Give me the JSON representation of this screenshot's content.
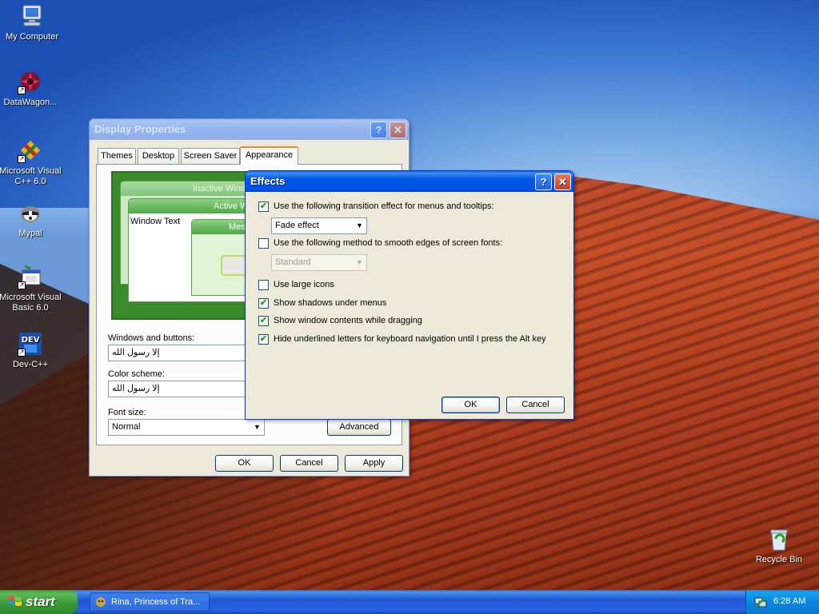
{
  "desktop": {
    "icons": [
      {
        "label": "My Computer",
        "icon": "my-computer-icon"
      },
      {
        "label": "DataWagon...",
        "icon": "datawagon-icon"
      },
      {
        "label": "Microsoft Visual C++ 6.0",
        "icon": "visual-cpp-icon"
      },
      {
        "label": "Mypal",
        "icon": "mypal-icon"
      },
      {
        "label": "Microsoft Visual Basic 6.0",
        "icon": "visual-basic-icon"
      },
      {
        "label": "Dev-C++",
        "icon": "dev-cpp-icon"
      },
      {
        "label": "Recycle Bin",
        "icon": "recycle-bin-icon"
      }
    ]
  },
  "display_properties": {
    "title": "Display Properties",
    "help_btn": "?",
    "close_btn": "✕",
    "tabs": [
      "Themes",
      "Desktop",
      "Screen Saver",
      "Appearance"
    ],
    "active_tab": "Appearance",
    "preview": {
      "inactive_title": "Inactive Window",
      "active_title": "Active Window",
      "window_text": "Window Text",
      "message_title": "Message Box"
    },
    "windows_buttons_label": "Windows and buttons:",
    "windows_buttons_value": "إلا رسول الله",
    "color_scheme_label": "Color scheme:",
    "color_scheme_value": "إلا رسول الله",
    "font_size_label": "Font size:",
    "font_size_value": "Normal",
    "advanced_button": "Advanced",
    "ok_button": "OK",
    "cancel_button": "Cancel",
    "apply_button": "Apply"
  },
  "effects": {
    "title": "Effects",
    "help_btn": "?",
    "close_btn": "✕",
    "transition_label": "Use the following transition effect for menus and tooltips:",
    "transition_checked": true,
    "transition_value": "Fade effect",
    "smooth_label": "Use the following method to smooth edges of screen fonts:",
    "smooth_checked": false,
    "smooth_value": "Standard",
    "large_icons_label": "Use large icons",
    "large_icons_checked": false,
    "shadows_label": "Show shadows under menus",
    "shadows_checked": true,
    "drag_label": "Show window contents while dragging",
    "drag_checked": true,
    "underline_label": "Hide underlined letters for keyboard navigation until I press the Alt key",
    "underline_checked": true,
    "ok_button": "OK",
    "cancel_button": "Cancel"
  },
  "taskbar": {
    "start_label": "start",
    "task_label": "Rina, Princess of Tra...",
    "clock": "6:28 AM"
  }
}
